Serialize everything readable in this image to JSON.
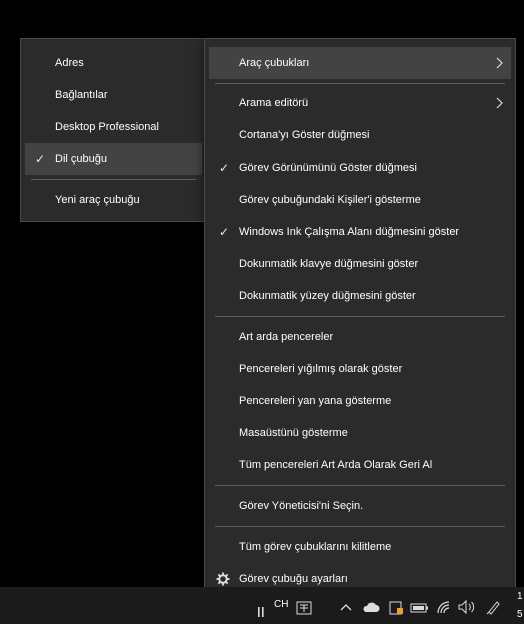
{
  "main_menu": {
    "items": [
      {
        "label": "Araç çubukları",
        "checked": false,
        "has_submenu": true,
        "highlighted": true
      },
      {
        "label": "Arama editörü",
        "checked": false,
        "has_submenu": true
      },
      {
        "label": "Cortana'yı Göster düğmesi",
        "checked": false
      },
      {
        "label": "Görev Görünümünü Göster düğmesi",
        "checked": true
      },
      {
        "label": "Görev çubuğundaki Kişiler'i gösterme",
        "checked": false
      },
      {
        "label": "Windows Ink Çalışma Alanı düğmesini göster",
        "checked": true
      },
      {
        "label": "Dokunmatik klavye düğmesini göster",
        "checked": false
      },
      {
        "label": "Dokunmatik yüzey düğmesini göster",
        "checked": false
      },
      {
        "label": "Art arda pencereler",
        "checked": false
      },
      {
        "label": "Pencereleri yığılmış olarak göster",
        "checked": false
      },
      {
        "label": "Pencereleri yan yana gösterme",
        "checked": false
      },
      {
        "label": "Masaüstünü gösterme",
        "checked": false
      },
      {
        "label": "Tüm pencereleri Art Arda Olarak Geri Al",
        "checked": false
      },
      {
        "label": "Görev Yöneticisi'ni Seçin.",
        "checked": false
      },
      {
        "label": "Tüm görev çubuklarını kilitleme",
        "checked": false
      },
      {
        "label": "Görev çubuğu ayarları",
        "checked": false,
        "icon": "gear-icon"
      }
    ]
  },
  "submenu": {
    "items": [
      {
        "label": "Adres",
        "checked": false
      },
      {
        "label": "Bağlantılar",
        "checked": false
      },
      {
        "label": "Desktop Professional",
        "checked": false
      },
      {
        "label": "Dil çubuğu",
        "checked": true,
        "highlighted": true
      },
      {
        "label": "Yeni araç çubuğu",
        "checked": false
      }
    ]
  },
  "taskbar": {
    "language": "CH",
    "clock_partial": [
      "1",
      "5"
    ],
    "icons": [
      "pause-icon",
      "ime-icon",
      "chevron-up-icon",
      "cloud-icon",
      "security-icon",
      "battery-icon",
      "wifi-icon",
      "volume-icon",
      "pen-icon"
    ]
  },
  "colors": {
    "menu_bg": "#2b2b2b",
    "highlight": "#434343",
    "separator": "#5e5e5e",
    "text": "#ffffff",
    "desktop_bg": "#000000",
    "taskbar_bg": "#1b1b1b"
  }
}
